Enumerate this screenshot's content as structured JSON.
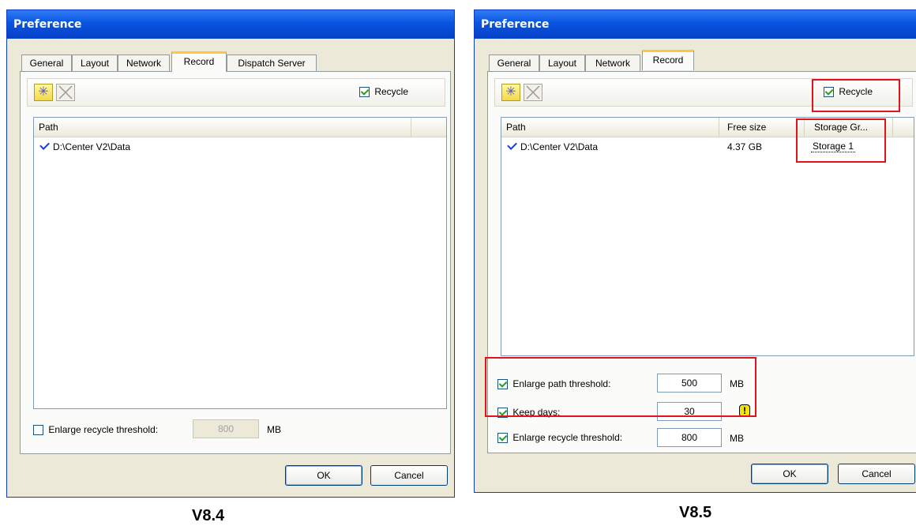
{
  "dialog_v84": {
    "title": "Preference",
    "tabs": [
      "General",
      "Layout",
      "Network",
      "Record",
      "Dispatch Server"
    ],
    "active_tab": "Record",
    "toolbar": {
      "new_icon": "asterisk-icon",
      "delete_icon": "x-box-icon"
    },
    "recycle_label": "Recycle",
    "recycle_checked": true,
    "columns": [
      "Path"
    ],
    "rows": [
      {
        "path": "D:\\Center V2\\Data",
        "checked": true
      }
    ],
    "enlarge_recycle": {
      "label": "Enlarge recycle threshold:",
      "checked": false,
      "value": "800",
      "unit": "MB"
    },
    "ok_label": "OK",
    "cancel_label": "Cancel",
    "caption": "V8.4"
  },
  "dialog_v85": {
    "title": "Preference",
    "tabs": [
      "General",
      "Layout",
      "Network",
      "Record"
    ],
    "active_tab": "Record",
    "toolbar": {
      "new_icon": "asterisk-icon",
      "delete_icon": "x-box-icon"
    },
    "recycle_label": "Recycle",
    "recycle_checked": true,
    "columns": [
      "Path",
      "Free size",
      "Storage Gr..."
    ],
    "rows": [
      {
        "path": "D:\\Center V2\\Data",
        "free_size": "4.37 GB",
        "storage_group": "Storage 1",
        "checked": true
      }
    ],
    "enlarge_path": {
      "label": "Enlarge path threshold:",
      "checked": true,
      "value": "500",
      "unit": "MB"
    },
    "keep_days": {
      "label": "Keep days:",
      "checked": true,
      "value": "30",
      "warning_icon": "exclamation-warning-icon"
    },
    "enlarge_recycle": {
      "label": "Enlarge recycle threshold:",
      "checked": true,
      "value": "800",
      "unit": "MB"
    },
    "ok_label": "OK",
    "cancel_label": "Cancel",
    "caption": "V8.5"
  },
  "colors": {
    "titlebar": "#0854e0",
    "highlight": "#e1141c",
    "dialog_bg": "#ece9d8"
  }
}
